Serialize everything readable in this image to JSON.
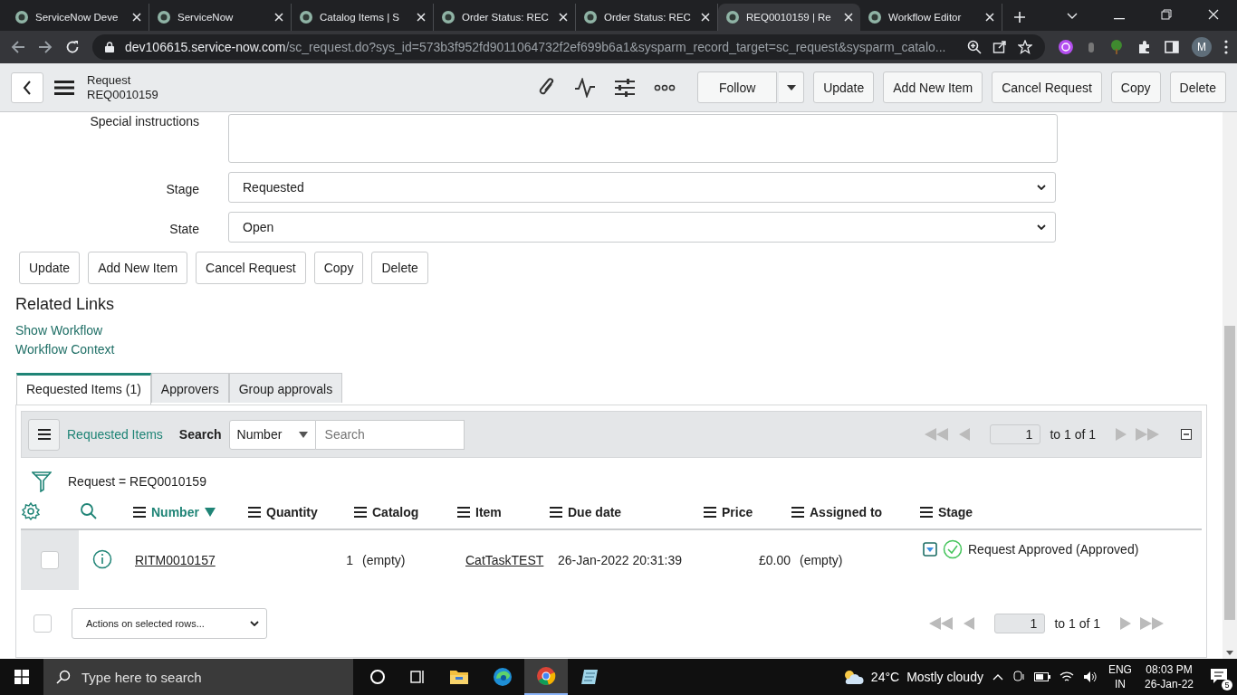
{
  "browser": {
    "tabs": [
      {
        "title": "ServiceNow Deve",
        "selected": false
      },
      {
        "title": "ServiceNow",
        "selected": false
      },
      {
        "title": "Catalog Items | S",
        "selected": false
      },
      {
        "title": "Order Status: REC",
        "selected": false
      },
      {
        "title": "Order Status: REC",
        "selected": false
      },
      {
        "title": "REQ0010159 | Re",
        "selected": true
      },
      {
        "title": "Workflow Editor",
        "selected": false
      }
    ],
    "url": {
      "host": "dev106615.service-now.com",
      "path": "/sc_request.do?sys_id=573b3f952fd9011064732f2ef699b6a1&sysparm_record_target=sc_request&sysparm_catalo..."
    },
    "profile_initial": "M"
  },
  "header": {
    "title": "Request",
    "number": "REQ0010159",
    "follow": "Follow",
    "buttons": [
      "Update",
      "Add New Item",
      "Cancel Request",
      "Copy",
      "Delete"
    ]
  },
  "form": {
    "special_instructions_label": "Special instructions",
    "fields": [
      {
        "label": "Stage",
        "value": "Requested"
      },
      {
        "label": "State",
        "value": "Open"
      }
    ],
    "buttons": [
      "Update",
      "Add New Item",
      "Cancel Request",
      "Copy",
      "Delete"
    ]
  },
  "related_links": {
    "title": "Related Links",
    "links": [
      "Show Workflow",
      "Workflow Context"
    ]
  },
  "related_lists": {
    "tabs": [
      {
        "label": "Requested Items (1)",
        "selected": true
      },
      {
        "label": "Approvers",
        "selected": false
      },
      {
        "label": "Group approvals",
        "selected": false
      }
    ],
    "list_title": "Requested Items",
    "search_label": "Search",
    "search_field": "Number",
    "search_placeholder": "Search",
    "page": "1",
    "page_total": "to 1 of 1",
    "filter": "Request = REQ0010159",
    "columns": [
      {
        "label": "Number",
        "kind": "text",
        "sorted": true
      },
      {
        "label": "Quantity",
        "kind": "numeric",
        "sorted": false
      },
      {
        "label": "Catalog",
        "kind": "text",
        "sorted": false
      },
      {
        "label": "Item",
        "kind": "text",
        "sorted": false
      },
      {
        "label": "Due date",
        "kind": "text",
        "sorted": false
      },
      {
        "label": "Price",
        "kind": "numeric",
        "sorted": false
      },
      {
        "label": "Assigned to",
        "kind": "text",
        "sorted": false
      },
      {
        "label": "Stage",
        "kind": "text",
        "sorted": false
      }
    ],
    "rows": [
      {
        "checked": false,
        "cells": [
          {
            "kind": "link",
            "text": "RITM0010157"
          },
          {
            "kind": "text",
            "text": "1"
          },
          {
            "kind": "text",
            "text": "(empty)"
          },
          {
            "kind": "link",
            "text": "CatTaskTEST"
          },
          {
            "kind": "text",
            "text": "26-Jan-2022 20:31:39"
          },
          {
            "kind": "text",
            "text": "£0.00"
          },
          {
            "kind": "text",
            "text": "(empty)"
          },
          {
            "kind": "stage",
            "text": "Request Approved (Approved)"
          }
        ]
      }
    ],
    "select_all_checked": false,
    "actions_placeholder": "Actions on selected rows...",
    "bottom_page": "1",
    "bottom_total": "to 1 of 1"
  },
  "taskbar": {
    "search_placeholder": "Type here to search",
    "temperature": "24°C",
    "weather": "Mostly cloudy",
    "language": "ENG",
    "region": "IN",
    "time": "08:03 PM",
    "date": "26-Jan-22",
    "notifications": "5"
  }
}
